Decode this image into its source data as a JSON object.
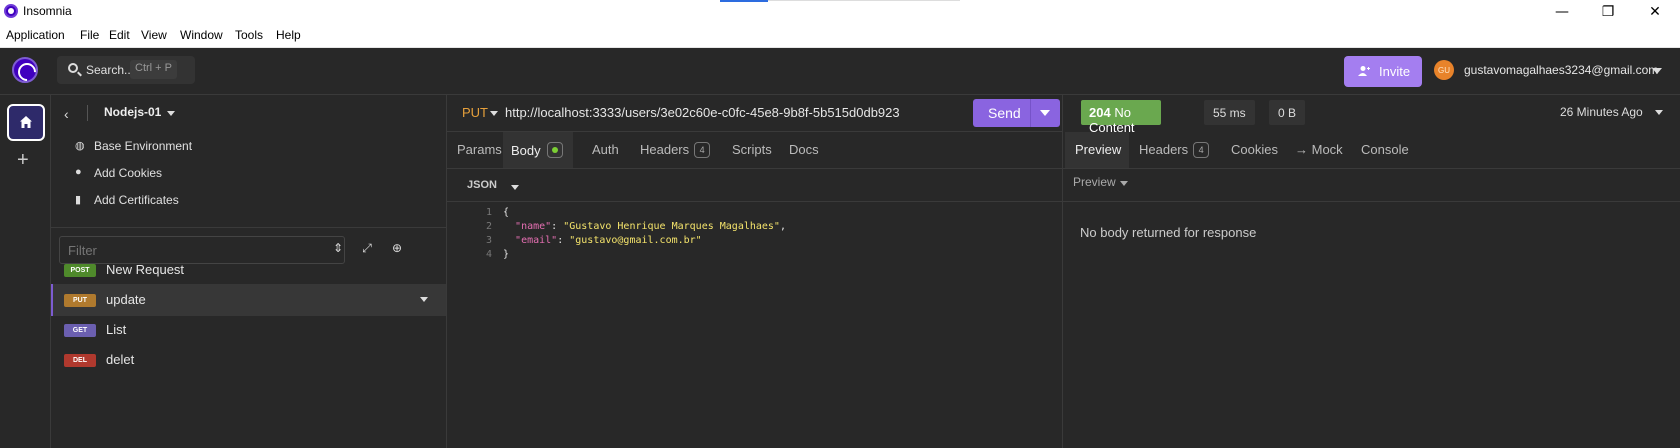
{
  "window": {
    "title": "Insomnia",
    "menu": [
      "Application",
      "File",
      "Edit",
      "View",
      "Window",
      "Tools",
      "Help"
    ],
    "controls": {
      "minimize": "—",
      "restore": "❐",
      "close": "✕"
    }
  },
  "header": {
    "search_label": "Search..",
    "search_shortcut": "Ctrl + P",
    "invite_label": "Invite",
    "avatar_initials": "GU",
    "user_email": "gustavomagalhaes3234@gmail.com"
  },
  "rail": {
    "add_symbol": "+"
  },
  "sidebar": {
    "back_symbol": "‹",
    "project_name": "Nodejs-01",
    "links": [
      {
        "label": "Base Environment",
        "icon": "globe-icon"
      },
      {
        "label": "Add Cookies",
        "icon": "cookie-icon"
      },
      {
        "label": "Add Certificates",
        "icon": "certificate-icon"
      }
    ],
    "filter_placeholder": "Filter",
    "requests": [
      {
        "method": "POST",
        "name": "New Request",
        "color": "#4f8a2b"
      },
      {
        "method": "PUT",
        "name": "update",
        "color": "#b07a2e"
      },
      {
        "method": "GET",
        "name": "List",
        "color": "#6b5fb0"
      },
      {
        "method": "DEL",
        "name": "delet",
        "color": "#b0392e"
      }
    ]
  },
  "request": {
    "method": "PUT",
    "url": "http://localhost:3333/users/3e02c60e-c0fc-45e8-9b8f-5b515d0db923",
    "send_label": "Send",
    "tabs": [
      {
        "label": "Params"
      },
      {
        "label": "Body"
      },
      {
        "label": "Auth"
      },
      {
        "label": "Headers",
        "count": "4"
      },
      {
        "label": "Scripts"
      },
      {
        "label": "Docs"
      }
    ],
    "body_type": "JSON",
    "body_lines": [
      {
        "num": "1",
        "key": "",
        "value": ""
      },
      {
        "num": "2",
        "key": "\"name\"",
        "value": "\"Gustavo Henrique Marques Magalhaes\""
      },
      {
        "num": "3",
        "key": "\"email\"",
        "value": "\"gustavo@gmail.com.br\""
      },
      {
        "num": "4",
        "key": "",
        "value": ""
      }
    ]
  },
  "response": {
    "status_code": "204",
    "status_text": "No Content",
    "time": "55 ms",
    "size": "0 B",
    "when": "26 Minutes Ago",
    "tabs": [
      {
        "label": "Preview"
      },
      {
        "label": "Headers",
        "count": "4"
      },
      {
        "label": "Cookies"
      },
      {
        "label": "→ Mock"
      },
      {
        "label": "Console"
      }
    ],
    "preview_mode": "Preview",
    "empty_message": "No body returned for response"
  },
  "colors": {
    "accent": "#8a64e0",
    "status_ok": "#6aa84f",
    "put_method": "#e6a03b"
  }
}
